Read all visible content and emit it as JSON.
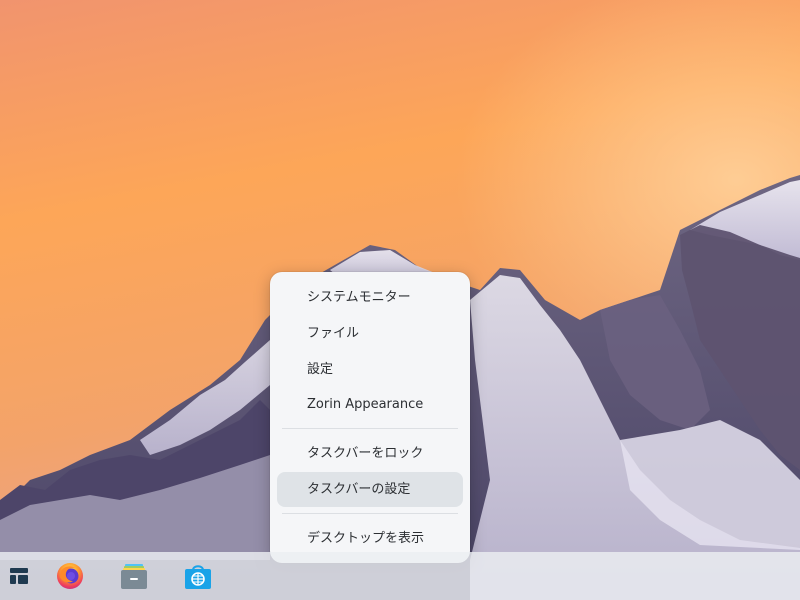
{
  "menu": {
    "items": [
      {
        "label": "システムモニター"
      },
      {
        "label": "ファイル"
      },
      {
        "label": "設定"
      },
      {
        "label": "Zorin Appearance"
      },
      {
        "label": "タスクバーをロック"
      },
      {
        "label": "タスクバーの設定",
        "highlighted": true
      },
      {
        "label": "デスクトップを表示"
      }
    ]
  },
  "taskbar": {
    "items": [
      {
        "icon": "zorin-menu-icon"
      },
      {
        "icon": "firefox-icon"
      },
      {
        "icon": "files-icon"
      },
      {
        "icon": "software-store-icon"
      }
    ]
  },
  "colors": {
    "menu_bg": "#f5f6f8",
    "menu_highlight": "#dfe3e7",
    "accent_blue": "#1aa3e8"
  }
}
